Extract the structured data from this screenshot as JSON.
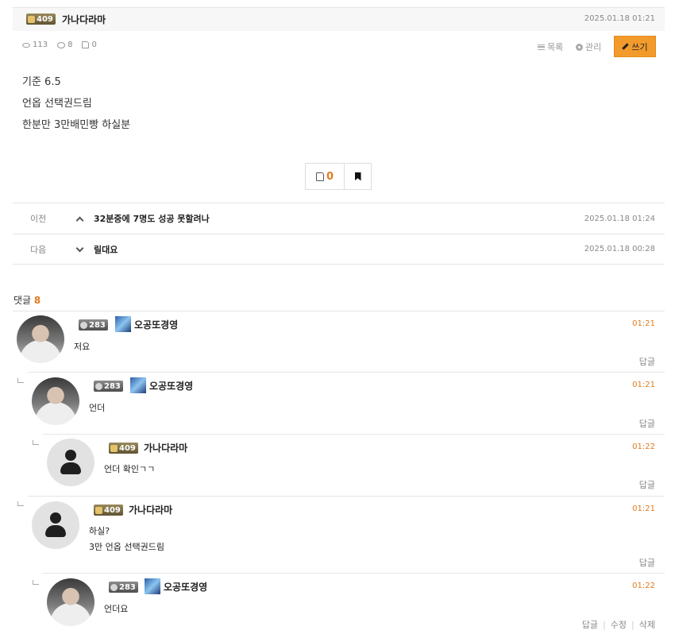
{
  "post": {
    "author": {
      "level": "409",
      "name": "가나다라마"
    },
    "date": "2025.01.18 01:21",
    "stats": {
      "views": "113",
      "comments": "8",
      "likes": "0"
    },
    "toolbar": {
      "list_label": "목록",
      "manage_label": "관리",
      "write_label": "쓰기"
    },
    "body_lines": [
      "기준 6.5",
      "언옵 선택권드림",
      "한분만 3만배민빵 하실분"
    ],
    "vote": {
      "likes": "0"
    }
  },
  "nav": {
    "prev": {
      "label": "이전",
      "title": "32분중에 7명도 성공 못할려나",
      "date": "2025.01.18 01:24"
    },
    "next": {
      "label": "다음",
      "title": "릴대요",
      "date": "2025.01.18 00:28"
    }
  },
  "comments_header": {
    "label": "댓글",
    "count": "8"
  },
  "comments": [
    {
      "level": "283",
      "name": "오공또경영",
      "time": "01:21",
      "lines": [
        "저요"
      ],
      "reply_label": "답글"
    },
    {
      "level": "283",
      "name": "오공또경영",
      "time": "01:21",
      "lines": [
        "언더"
      ],
      "reply_label": "답글"
    },
    {
      "level": "409",
      "name": "가나다라마",
      "time": "01:22",
      "lines": [
        "언더 확인ㄱㄱ"
      ],
      "reply_label": "답글"
    },
    {
      "level": "409",
      "name": "가나다라마",
      "time": "01:21",
      "lines": [
        "하실?",
        "3만 언옵 선택권드림"
      ],
      "reply_label": "답글"
    },
    {
      "level": "283",
      "name": "오공또경영",
      "time": "01:22",
      "lines": [
        "언더요"
      ],
      "reply_label": "답글",
      "edit_label": "수정",
      "delete_label": "삭제"
    }
  ],
  "colors": {
    "accent": "#e07b1f",
    "write_button": "#f29b2c"
  }
}
